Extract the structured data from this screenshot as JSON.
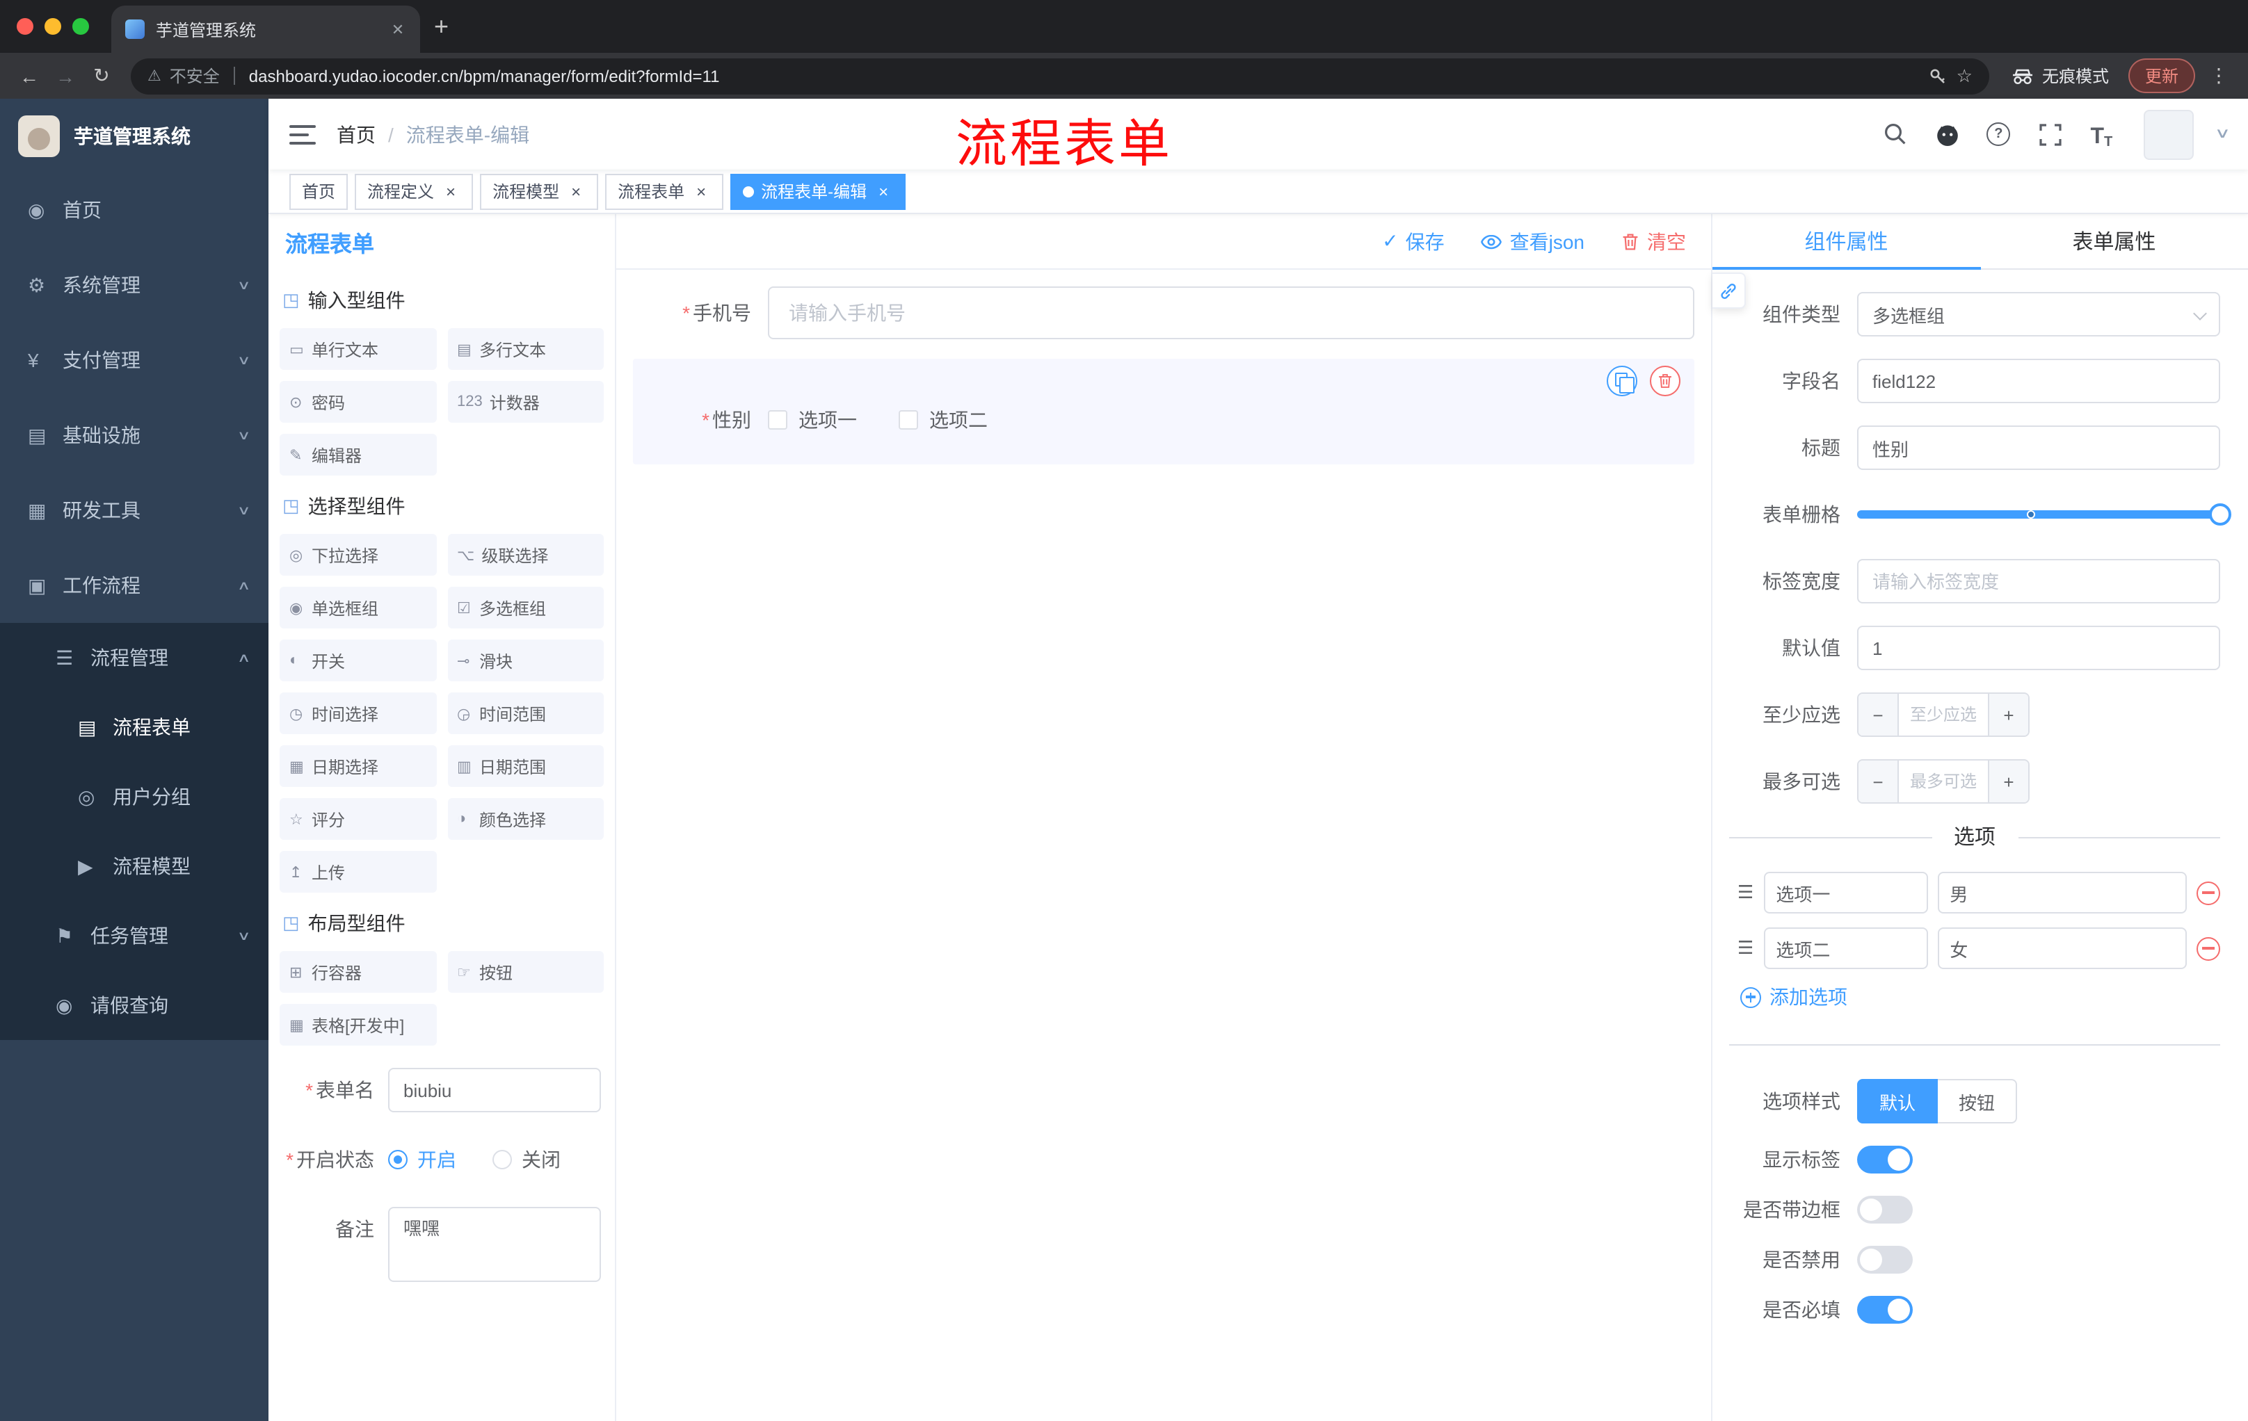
{
  "theme": {
    "accent": "#409eff",
    "danger": "#f56c6c",
    "sidebar_bg": "#304156",
    "sidebar_sub_bg": "#1f2d3d",
    "selected_field_bg": "#f6f7ff",
    "annotation_red": "#fd0d0d"
  },
  "glyphs": {
    "close_tab": "✕",
    "close_tag": "×",
    "new_tab": "+",
    "back": "←",
    "forward": "→",
    "reload": "↻",
    "warning": "⚠",
    "star": "☆",
    "kebab": "⋮",
    "question": "?",
    "font_large": "T",
    "font_small": "T",
    "check": "✓",
    "caret_down": "∨",
    "required": "*",
    "minus": "−",
    "plus": "+",
    "drag": "☰"
  },
  "browser": {
    "tab_title": "芋道管理系统",
    "security_label": "不安全",
    "url": "dashboard.yudao.iocoder.cn/bpm/manager/form/edit?formId=11",
    "incognito_label": "无痕模式",
    "update_label": "更新"
  },
  "annotation": "流程表单",
  "sidebar": {
    "title": "芋道管理系统",
    "menu": [
      {
        "label": "首页",
        "icon": "◉"
      },
      {
        "label": "系统管理",
        "icon": "⚙",
        "chevron": "∨"
      },
      {
        "label": "支付管理",
        "icon": "¥",
        "chevron": "∨"
      },
      {
        "label": "基础设施",
        "icon": "▤",
        "chevron": "∨"
      },
      {
        "label": "研发工具",
        "icon": "▦",
        "chevron": "∨"
      },
      {
        "label": "工作流程",
        "icon": "▣",
        "chevron": "∧"
      }
    ],
    "submenu": [
      {
        "label": "流程管理",
        "icon": "☰",
        "chevron": "∧"
      },
      {
        "label": "流程表单",
        "icon": "▤",
        "active": true
      },
      {
        "label": "用户分组",
        "icon": "◎"
      },
      {
        "label": "流程模型",
        "icon": "▶"
      },
      {
        "label": "任务管理",
        "icon": "⚑",
        "chevron": "∨"
      },
      {
        "label": "请假查询",
        "icon": "◉"
      }
    ]
  },
  "header": {
    "breadcrumb": {
      "home": "首页",
      "separator": "/",
      "current": "流程表单-编辑"
    }
  },
  "tags": [
    {
      "label": "首页",
      "closable": false,
      "active": false
    },
    {
      "label": "流程定义",
      "closable": true,
      "active": false
    },
    {
      "label": "流程模型",
      "closable": true,
      "active": false
    },
    {
      "label": "流程表单",
      "closable": true,
      "active": false
    },
    {
      "label": "流程表单-编辑",
      "closable": true,
      "active": true
    }
  ],
  "designer": {
    "panel_title": "流程表单",
    "groups": [
      {
        "title": "输入型组件",
        "icon": "◳",
        "items": [
          {
            "label": "单行文本",
            "icon": "▭",
            "icon_name": "single-line-text-icon"
          },
          {
            "label": "多行文本",
            "icon": "▤",
            "icon_name": "textarea-icon"
          },
          {
            "label": "密码",
            "icon": "⊙",
            "icon_name": "password-icon"
          },
          {
            "label": "计数器",
            "icon": "123",
            "icon_name": "counter-icon"
          },
          {
            "label": "编辑器",
            "icon": "✎",
            "icon_name": "editor-icon"
          }
        ]
      },
      {
        "title": "选择型组件",
        "icon": "◳",
        "items": [
          {
            "label": "下拉选择",
            "icon": "◎",
            "icon_name": "select-icon"
          },
          {
            "label": "级联选择",
            "icon": "⌥",
            "icon_name": "cascader-icon"
          },
          {
            "label": "单选框组",
            "icon": "◉",
            "icon_name": "radio-group-icon"
          },
          {
            "label": "多选框组",
            "icon": "☑",
            "icon_name": "checkbox-group-icon"
          },
          {
            "label": "开关",
            "icon": "◐",
            "icon_name": "switch-icon"
          },
          {
            "label": "滑块",
            "icon": "⊸",
            "icon_name": "slider-icon"
          },
          {
            "label": "时间选择",
            "icon": "◷",
            "icon_name": "time-picker-icon"
          },
          {
            "label": "时间范围",
            "icon": "◶",
            "icon_name": "time-range-icon"
          },
          {
            "label": "日期选择",
            "icon": "▦",
            "icon_name": "date-picker-icon"
          },
          {
            "label": "日期范围",
            "icon": "▥",
            "icon_name": "date-range-icon"
          },
          {
            "label": "评分",
            "icon": "☆",
            "icon_name": "rate-icon"
          },
          {
            "label": "颜色选择",
            "icon": "◑",
            "icon_name": "color-picker-icon"
          },
          {
            "label": "上传",
            "icon": "↥",
            "icon_name": "upload-icon"
          }
        ]
      },
      {
        "title": "布局型组件",
        "icon": "◳",
        "items": [
          {
            "label": "行容器",
            "icon": "⊞",
            "icon_name": "row-container-icon"
          },
          {
            "label": "按钮",
            "icon": "☞",
            "icon_name": "button-icon"
          },
          {
            "label": "表格[开发中]",
            "icon": "▦",
            "icon_name": "table-icon"
          }
        ]
      }
    ],
    "meta": {
      "name_label": "表单名",
      "name_value": "biubiu",
      "status_label": "开启状态",
      "status_options": [
        "开启",
        "关闭"
      ],
      "status_value": "开启",
      "remark_label": "备注",
      "remark_value": "嘿嘿"
    }
  },
  "canvas": {
    "save_label": "保存",
    "view_json_label": "查看json",
    "clear_label": "清空",
    "phone_label": "手机号",
    "phone_placeholder": "请输入手机号",
    "gender_label": "性别",
    "gender_options": [
      "选项一",
      "选项二"
    ]
  },
  "properties": {
    "tabs": [
      "组件属性",
      "表单属性"
    ],
    "active_tab": "组件属性",
    "component_type_label": "组件类型",
    "component_type_value": "多选框组",
    "field_name_label": "字段名",
    "field_name_value": "field122",
    "title_label": "标题",
    "title_value": "性别",
    "grid_label": "表单栅格",
    "label_width_label": "标签宽度",
    "label_width_placeholder": "请输入标签宽度",
    "default_label": "默认值",
    "default_value": "1",
    "min_label": "至少应选",
    "min_placeholder": "至少应选",
    "max_label": "最多可选",
    "max_placeholder": "最多可选",
    "options_title": "选项",
    "options": [
      {
        "label": "选项一",
        "value": "男"
      },
      {
        "label": "选项二",
        "value": "女"
      }
    ],
    "add_option_label": "添加选项",
    "style_label": "选项样式",
    "style_options": [
      "默认",
      "按钮"
    ],
    "style_value": "默认",
    "toggles": [
      {
        "label": "显示标签",
        "on": true
      },
      {
        "label": "是否带边框",
        "on": false
      },
      {
        "label": "是否禁用",
        "on": false
      },
      {
        "label": "是否必填",
        "on": true
      }
    ]
  }
}
